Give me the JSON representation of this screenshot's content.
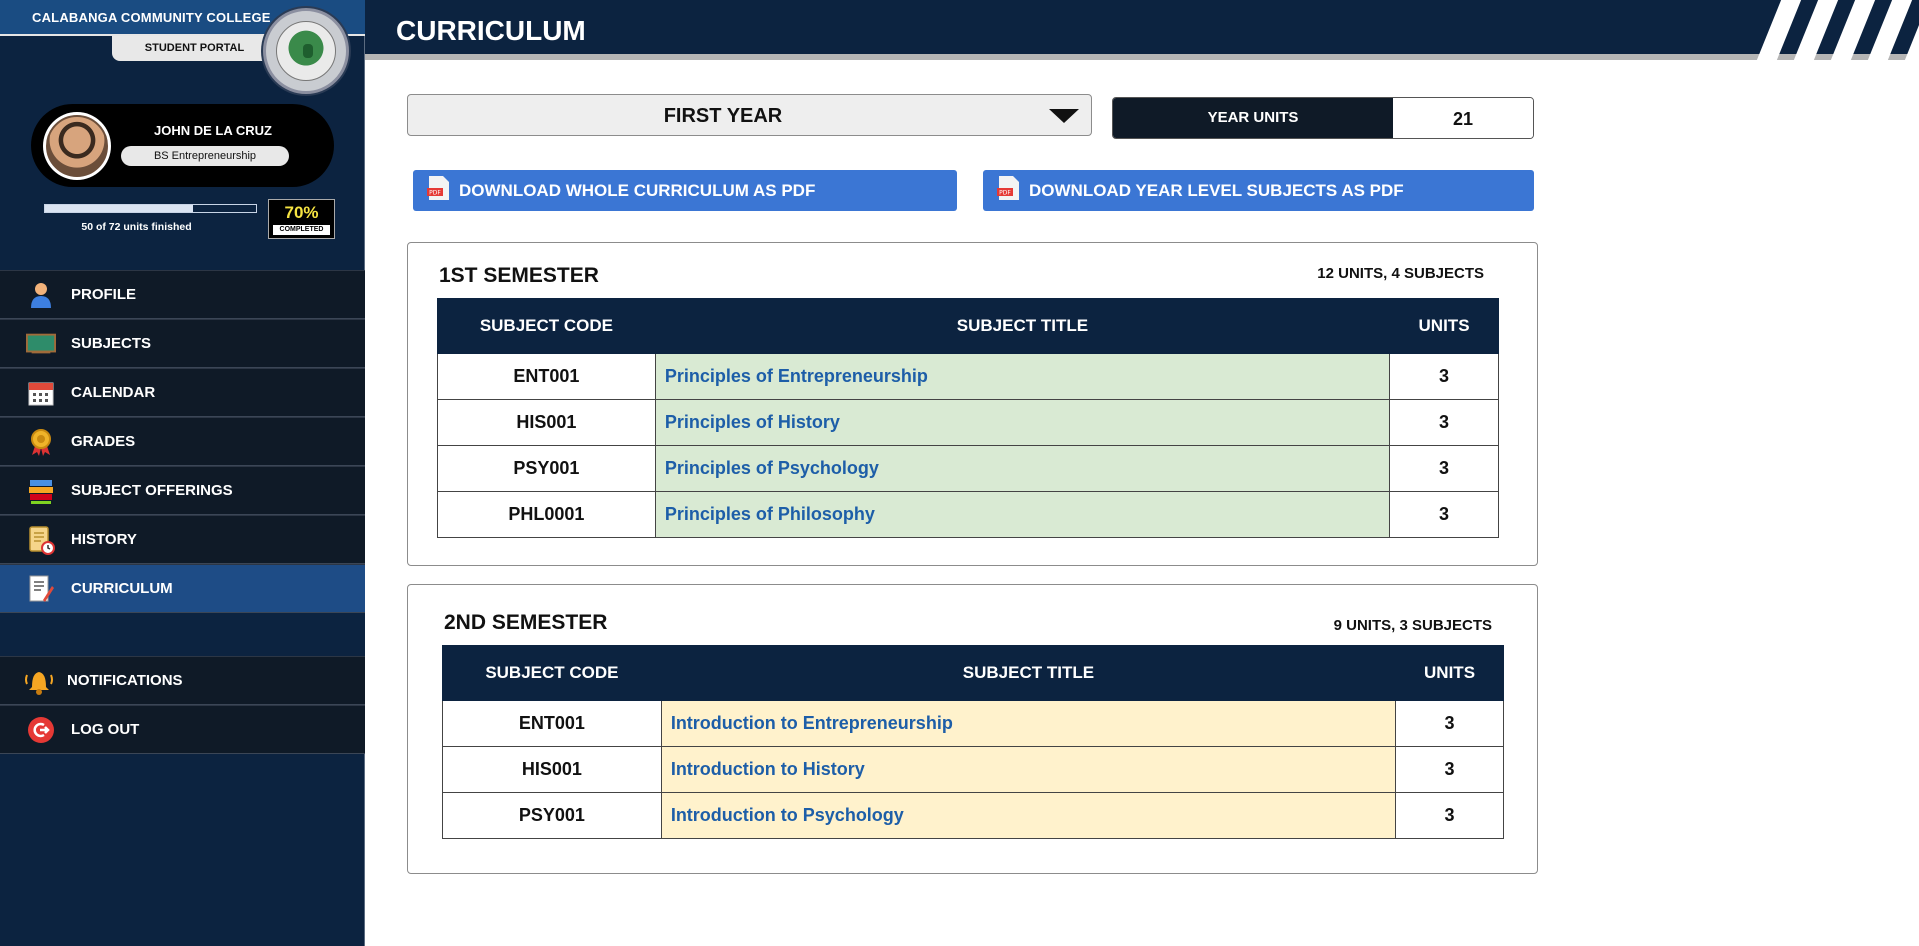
{
  "sidebar": {
    "college_name": "CALABANGA COMMUNITY COLLEGE",
    "portal_label": "STUDENT PORTAL",
    "user": {
      "name": "JOHN DE LA CRUZ",
      "program": "BS Entrepreneurship"
    },
    "progress": {
      "fraction": 0.7,
      "text": "50 of 72 units finished",
      "percent_label": "70%",
      "status_label": "COMPLETED"
    },
    "nav": [
      {
        "label": "PROFILE",
        "icon": "user-icon"
      },
      {
        "label": "SUBJECTS",
        "icon": "chalkboard-icon"
      },
      {
        "label": "CALENDAR",
        "icon": "calendar-icon"
      },
      {
        "label": "GRADES",
        "icon": "medal-icon"
      },
      {
        "label": "SUBJECT OFFERINGS",
        "icon": "books-icon"
      },
      {
        "label": "HISTORY",
        "icon": "scroll-clock-icon"
      },
      {
        "label": "CURRICULUM",
        "icon": "document-pencil-icon",
        "active": true
      }
    ],
    "nav_bottom": [
      {
        "label": "NOTIFICATIONS",
        "icon": "bell-icon"
      },
      {
        "label": "LOG OUT",
        "icon": "logout-icon"
      }
    ]
  },
  "header": {
    "title": "CURRICULUM"
  },
  "controls": {
    "year_select": "FIRST YEAR",
    "year_units_label": "YEAR UNITS",
    "year_units_value": "21",
    "download_whole": "DOWNLOAD WHOLE CURRICULUM AS PDF",
    "download_year": "DOWNLOAD YEAR LEVEL SUBJECTS AS PDF"
  },
  "columns": {
    "code": "SUBJECT CODE",
    "title": "SUBJECT TITLE",
    "units": "UNITS"
  },
  "semesters": [
    {
      "title": "1ST SEMESTER",
      "summary": "12 UNITS, 4 SUBJECTS",
      "subjects": [
        {
          "code": "ENT001",
          "title": "Principles of Entrepreneurship",
          "units": "3"
        },
        {
          "code": "HIS001",
          "title": "Principles of History",
          "units": "3"
        },
        {
          "code": "PSY001",
          "title": "Principles of Psychology",
          "units": "3"
        },
        {
          "code": "PHL0001",
          "title": "Principles of Philosophy",
          "units": "3"
        }
      ]
    },
    {
      "title": "2ND SEMESTER",
      "summary": "9 UNITS, 3 SUBJECTS",
      "subjects": [
        {
          "code": "ENT001",
          "title": "Introduction to Entrepreneurship",
          "units": "3"
        },
        {
          "code": "HIS001",
          "title": "Introduction to History",
          "units": "3"
        },
        {
          "code": "PSY001",
          "title": "Introduction to Psychology",
          "units": "3"
        }
      ]
    }
  ],
  "colors": {
    "navy": "#0c2340",
    "accent_blue": "#3b76d4",
    "sem1_row": "#d9ead3",
    "sem2_row": "#fff2cc",
    "link": "#1d5ea8",
    "percent": "#f5e342"
  }
}
